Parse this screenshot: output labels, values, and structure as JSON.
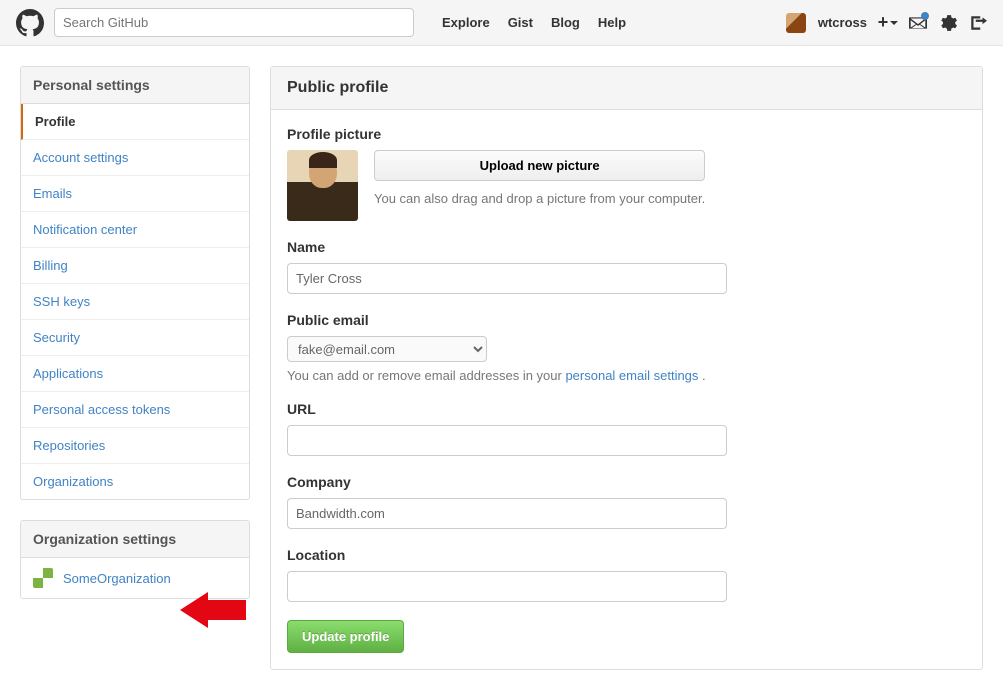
{
  "topbar": {
    "search_placeholder": "Search GitHub",
    "nav": {
      "explore": "Explore",
      "gist": "Gist",
      "blog": "Blog",
      "help": "Help"
    },
    "username": "wtcross"
  },
  "sidebar": {
    "personal_header": "Personal settings",
    "items": [
      "Profile",
      "Account settings",
      "Emails",
      "Notification center",
      "Billing",
      "SSH keys",
      "Security",
      "Applications",
      "Personal access tokens",
      "Repositories",
      "Organizations"
    ],
    "org_header": "Organization settings",
    "org_name": "SomeOrganization"
  },
  "profile": {
    "panel_title": "Public profile",
    "picture_label": "Profile picture",
    "upload_button": "Upload new picture",
    "upload_hint": "You can also drag and drop a picture from your computer.",
    "name_label": "Name",
    "name_value": "Tyler Cross",
    "email_label": "Public email",
    "email_value": "fake@email.com",
    "email_note_pre": "You can add or remove email addresses in your ",
    "email_note_link": "personal email settings",
    "email_note_post": " .",
    "url_label": "URL",
    "url_value": "",
    "company_label": "Company",
    "company_value": "Bandwidth.com",
    "location_label": "Location",
    "location_value": "",
    "submit_button": "Update profile"
  }
}
